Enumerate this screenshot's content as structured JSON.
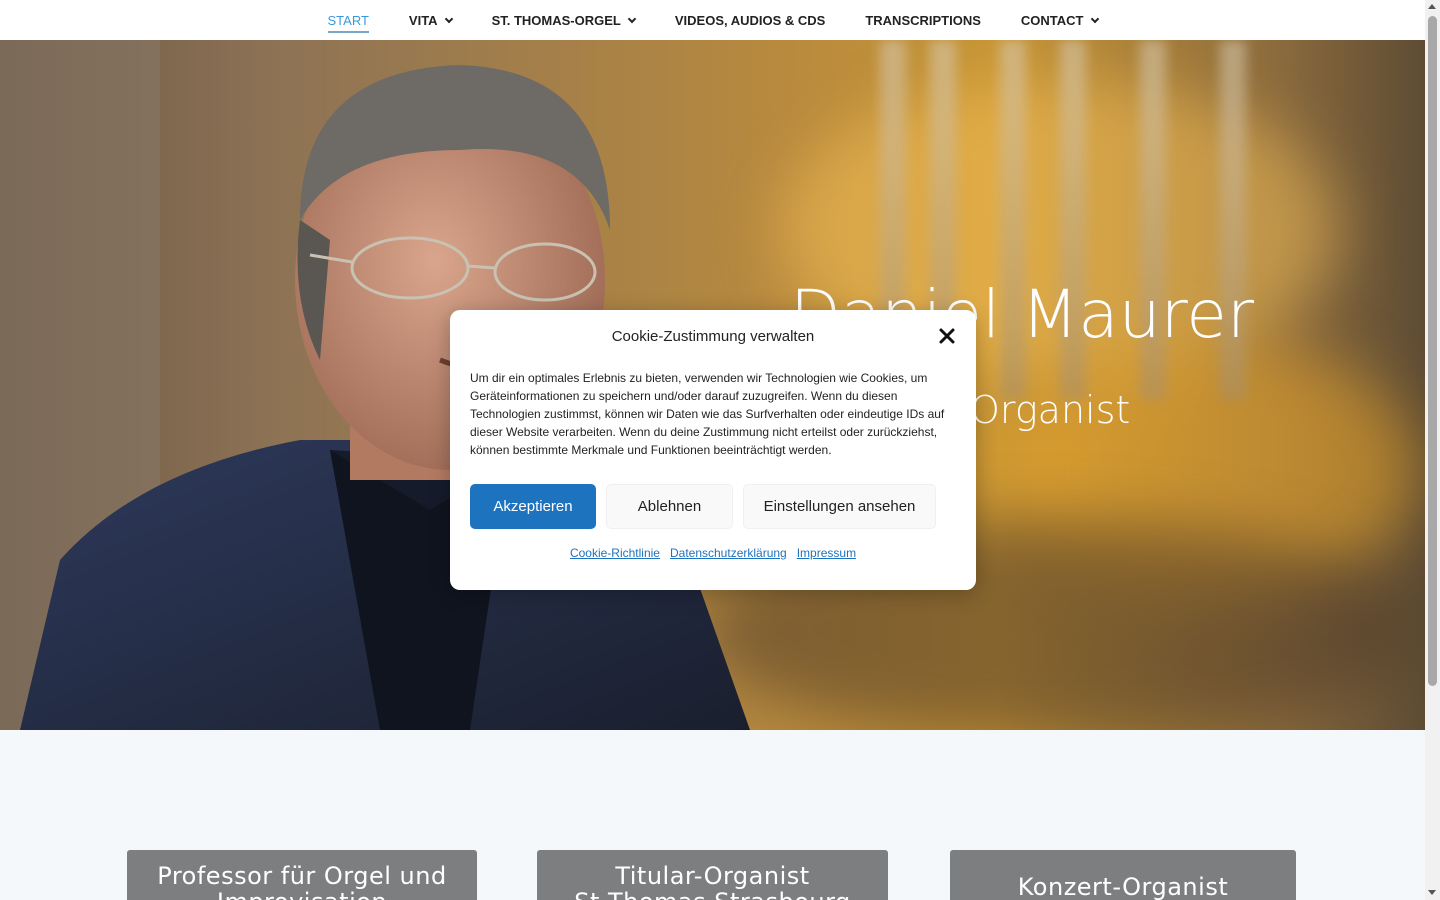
{
  "nav": {
    "items": [
      {
        "label": "START",
        "active": true,
        "dropdown": false
      },
      {
        "label": "VITA",
        "active": false,
        "dropdown": true
      },
      {
        "label": "ST. THOMAS-ORGEL",
        "active": false,
        "dropdown": true
      },
      {
        "label": "VIDEOS, AUDIOS & CDS",
        "active": false,
        "dropdown": false
      },
      {
        "label": "TRANSCRIPTIONS",
        "active": false,
        "dropdown": false
      },
      {
        "label": "CONTACT",
        "active": false,
        "dropdown": true
      }
    ],
    "active_color": "#3a9ad9"
  },
  "hero": {
    "name": "Daniel Maurer",
    "subtitle": "Organist"
  },
  "cookie_modal": {
    "title": "Cookie-Zustimmung verwalten",
    "text": "Um dir ein optimales Erlebnis zu bieten, verwenden wir Technologien wie Cookies, um Geräteinformationen zu speichern und/oder darauf zuzugreifen. Wenn du diesen Technologien zustimmst, können wir Daten wie das Surfverhalten oder eindeutige IDs auf dieser Website verarbeiten. Wenn du deine Zustimmung nicht erteilst oder zurückziehst, können bestimmte Merkmale und Funktionen beeinträchtigt werden.",
    "accept_label": "Akzeptieren",
    "deny_label": "Ablehnen",
    "settings_label": "Einstellungen ansehen",
    "links": [
      "Cookie-Richtlinie",
      "Datenschutzerklärung",
      "Impressum"
    ],
    "accent_color": "#1e73be"
  },
  "cards": [
    {
      "line1": "Professor für Orgel und",
      "line2": "Improvisation"
    },
    {
      "line1": "Titular-Organist",
      "line2": "St Thomas Strasbourg"
    },
    {
      "line1": "Konzert-Organist",
      "line2": ""
    }
  ]
}
